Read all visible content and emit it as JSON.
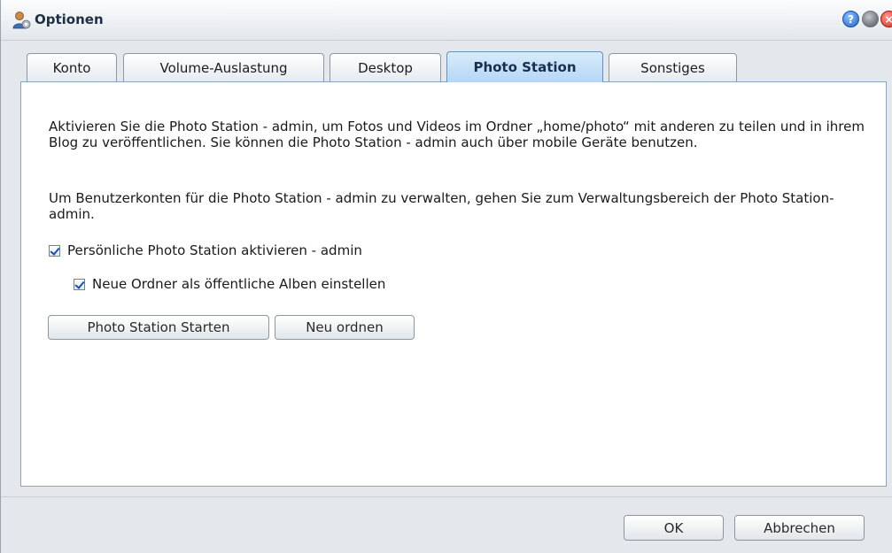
{
  "window": {
    "title": "Optionen",
    "icons": {
      "app": "user-settings-icon",
      "help": "help-icon",
      "minimize": "minimize-icon",
      "close": "close-icon"
    }
  },
  "tabs": [
    {
      "label": "Konto",
      "active": false
    },
    {
      "label": "Volume-Auslastung",
      "active": false
    },
    {
      "label": "Desktop",
      "active": false
    },
    {
      "label": "Photo Station",
      "active": true
    },
    {
      "label": "Sonstiges",
      "active": false
    }
  ],
  "content": {
    "paragraph1": "Aktivieren Sie die Photo Station - admin, um Fotos und Videos im Ordner „home/photo“ mit anderen zu teilen und in ihrem Blog zu veröffentlichen. Sie können die Photo Station - admin auch über mobile Geräte benutzen.",
    "paragraph2": "Um Benutzerkonten für die Photo Station - admin zu verwalten, gehen Sie zum Verwaltungsbereich der Photo Station- admin.",
    "checkbox_enable": {
      "label": "Persönliche Photo Station aktivieren - admin",
      "checked": true
    },
    "checkbox_public_albums": {
      "label": "Neue Ordner als öffentliche Alben einstellen",
      "checked": true
    },
    "start_button": "Photo Station Starten",
    "reorder_button": "Neu ordnen"
  },
  "footer": {
    "ok_button": "OK",
    "cancel_button": "Abbrechen"
  },
  "colors": {
    "active_tab": "#b6d6f3",
    "content_border": "#8aa3be",
    "checkmark": "#1f4f9a"
  }
}
